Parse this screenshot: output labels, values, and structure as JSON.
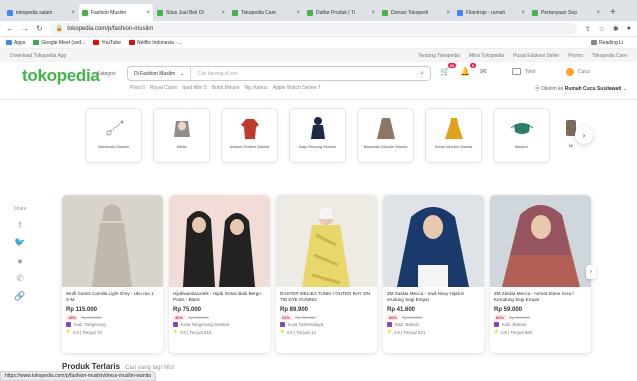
{
  "browser": {
    "tabs": [
      {
        "label": "tokopedia salam",
        "color": "#4285f4",
        "active": false
      },
      {
        "label": "Fashion Muslim",
        "color": "#42b549",
        "active": true
      },
      {
        "label": "Situs Jual Beli Ol",
        "color": "#42b549",
        "active": false
      },
      {
        "label": "Tokopedia Care",
        "color": "#42b549",
        "active": false
      },
      {
        "label": "Daftar Produk | Ti",
        "color": "#42b549",
        "active": false
      },
      {
        "label": "Donasi Tokopedi",
        "color": "#42b549",
        "active": false
      },
      {
        "label": "Filantropi - rumah",
        "color": "#4285f4",
        "active": false
      },
      {
        "label": "Pertanyaan Sep",
        "color": "#42b549",
        "active": false
      }
    ],
    "new_tab": "+",
    "url": "tokopedia.com/p/fashion-muslim",
    "bookmarks": [
      {
        "label": "Apps",
        "color": "#4285f4"
      },
      {
        "label": "Google Meet (sed...",
        "color": "#34a853"
      },
      {
        "label": "YouTube",
        "color": "#ff0000"
      },
      {
        "label": "Netflix Indonesia -...",
        "color": "#e50914"
      }
    ],
    "reading_list": "Reading Li"
  },
  "topstrip": {
    "download": "Download Tokopedia App",
    "links": [
      "Tentang Tokopedia",
      "Mitra Tokopedia",
      "Pusat Edukasi Seller",
      "Promo",
      "Tokopedia Care"
    ]
  },
  "header": {
    "logo": "tokopedia",
    "kategori": "Kategori",
    "search_scope": "Di Fashion Muslim",
    "search_placeholder": "Cari barang di sini",
    "cart_count": "40",
    "notif_count": "5",
    "toko": "Toko",
    "user": "Cucu",
    "suggestions": [
      "Pixel 6",
      "Royal Canin",
      "Ipad Mini 5",
      "Botol Minum",
      "Nju Kairoz",
      "Apple Watch Series 7"
    ],
    "location_prefix": "Dikirim ke",
    "location_name": "Rumah Cucu Susilawati"
  },
  "categories": [
    {
      "label": "Aksesoris Muslim",
      "icon": "tasbih-icon",
      "color": "#9e9e9e"
    },
    {
      "label": "Jilbab",
      "icon": "hijab-icon",
      "color": "#8d8d8d"
    },
    {
      "label": "Atasan Muslim Wanita",
      "icon": "blouse-icon",
      "color": "#c0392b"
    },
    {
      "label": "Baju Renang Muslim",
      "icon": "swimsuit-icon",
      "color": "#1f2a44"
    },
    {
      "label": "Bawahan Muslim Wanita",
      "icon": "skirt-icon",
      "color": "#8b7765"
    },
    {
      "label": "Dress Muslim Wanita",
      "icon": "dress-icon",
      "color": "#e0a11b"
    },
    {
      "label": "Masker",
      "icon": "mask-icon",
      "color": "#2e7d6b"
    },
    {
      "label": "Mi",
      "icon": "partial-icon",
      "color": "#7a6a5a"
    }
  ],
  "share": {
    "label": "Share",
    "icons": [
      {
        "name": "facebook-icon",
        "glyph": "f"
      },
      {
        "name": "twitter-icon",
        "glyph": "🐦"
      },
      {
        "name": "line-icon",
        "glyph": "●"
      },
      {
        "name": "whatsapp-icon",
        "glyph": "✆"
      },
      {
        "name": "copy-link-icon",
        "glyph": "🔗"
      }
    ]
  },
  "products": [
    {
      "name": "Wulfi Gamis Camilla Light Grey - Uku ran 1 S-M",
      "price": "Rp 115.000",
      "discount": "19%",
      "old_price": "Rp 155.000",
      "city": "Kab. Tangerang",
      "rating": "4.9 | Terjual 75",
      "bg": "#d8d4cc",
      "accent": "#bfb8ad"
    },
    {
      "name": "Hijabwanitacantik - Hijab Instan Baiti Bergo Polos - Black",
      "price": "Rp 75.000",
      "discount": "30%",
      "old_price": "Rp 100.000",
      "city": "Kota Tangerang Selatan",
      "rating": "4.9 | Terjual 515",
      "bg": "#f2dcd8",
      "accent": "#222222"
    },
    {
      "name": "DASTER MELIKA TUNIK / OUTER RAY ON TIE DYE KUNING",
      "price": "Rp 89.900",
      "discount": "22%",
      "old_price": "Rp 115.000",
      "city": "Kota Tasikmalaya",
      "rating": "4.9 | Terjual 14",
      "bg": "#eeeae4",
      "accent": "#e8d76a"
    },
    {
      "name": "ZM Zaskia Mecca - Sadi Navy Hijab K erudung Segi Empat",
      "price": "Rp 41.600",
      "discount": "60%",
      "old_price": "Rp 110.000",
      "city": "Kab. Bekasi",
      "rating": "4.9 | Terjual 521",
      "bg": "#dfe3e8",
      "accent": "#1a3a6b"
    },
    {
      "name": "ZM Zaskia Mecca - Asmat Stone Scra f Kerudung Segi Empat",
      "price": "Rp 59.000",
      "discount": "60%",
      "old_price": "Rp 150.000",
      "city": "Kab. Bekasi",
      "rating": "4.9 | Terjual 882",
      "bg": "#cfd6dc",
      "accent": "#b25f55"
    }
  ],
  "terlaris": {
    "title": "Produk Terlaris",
    "subtitle": "Cari yang lagi hits!"
  },
  "status_url": "https://www.tokopedia.com/p/fashion-muslim/dress-muslim-wanita"
}
